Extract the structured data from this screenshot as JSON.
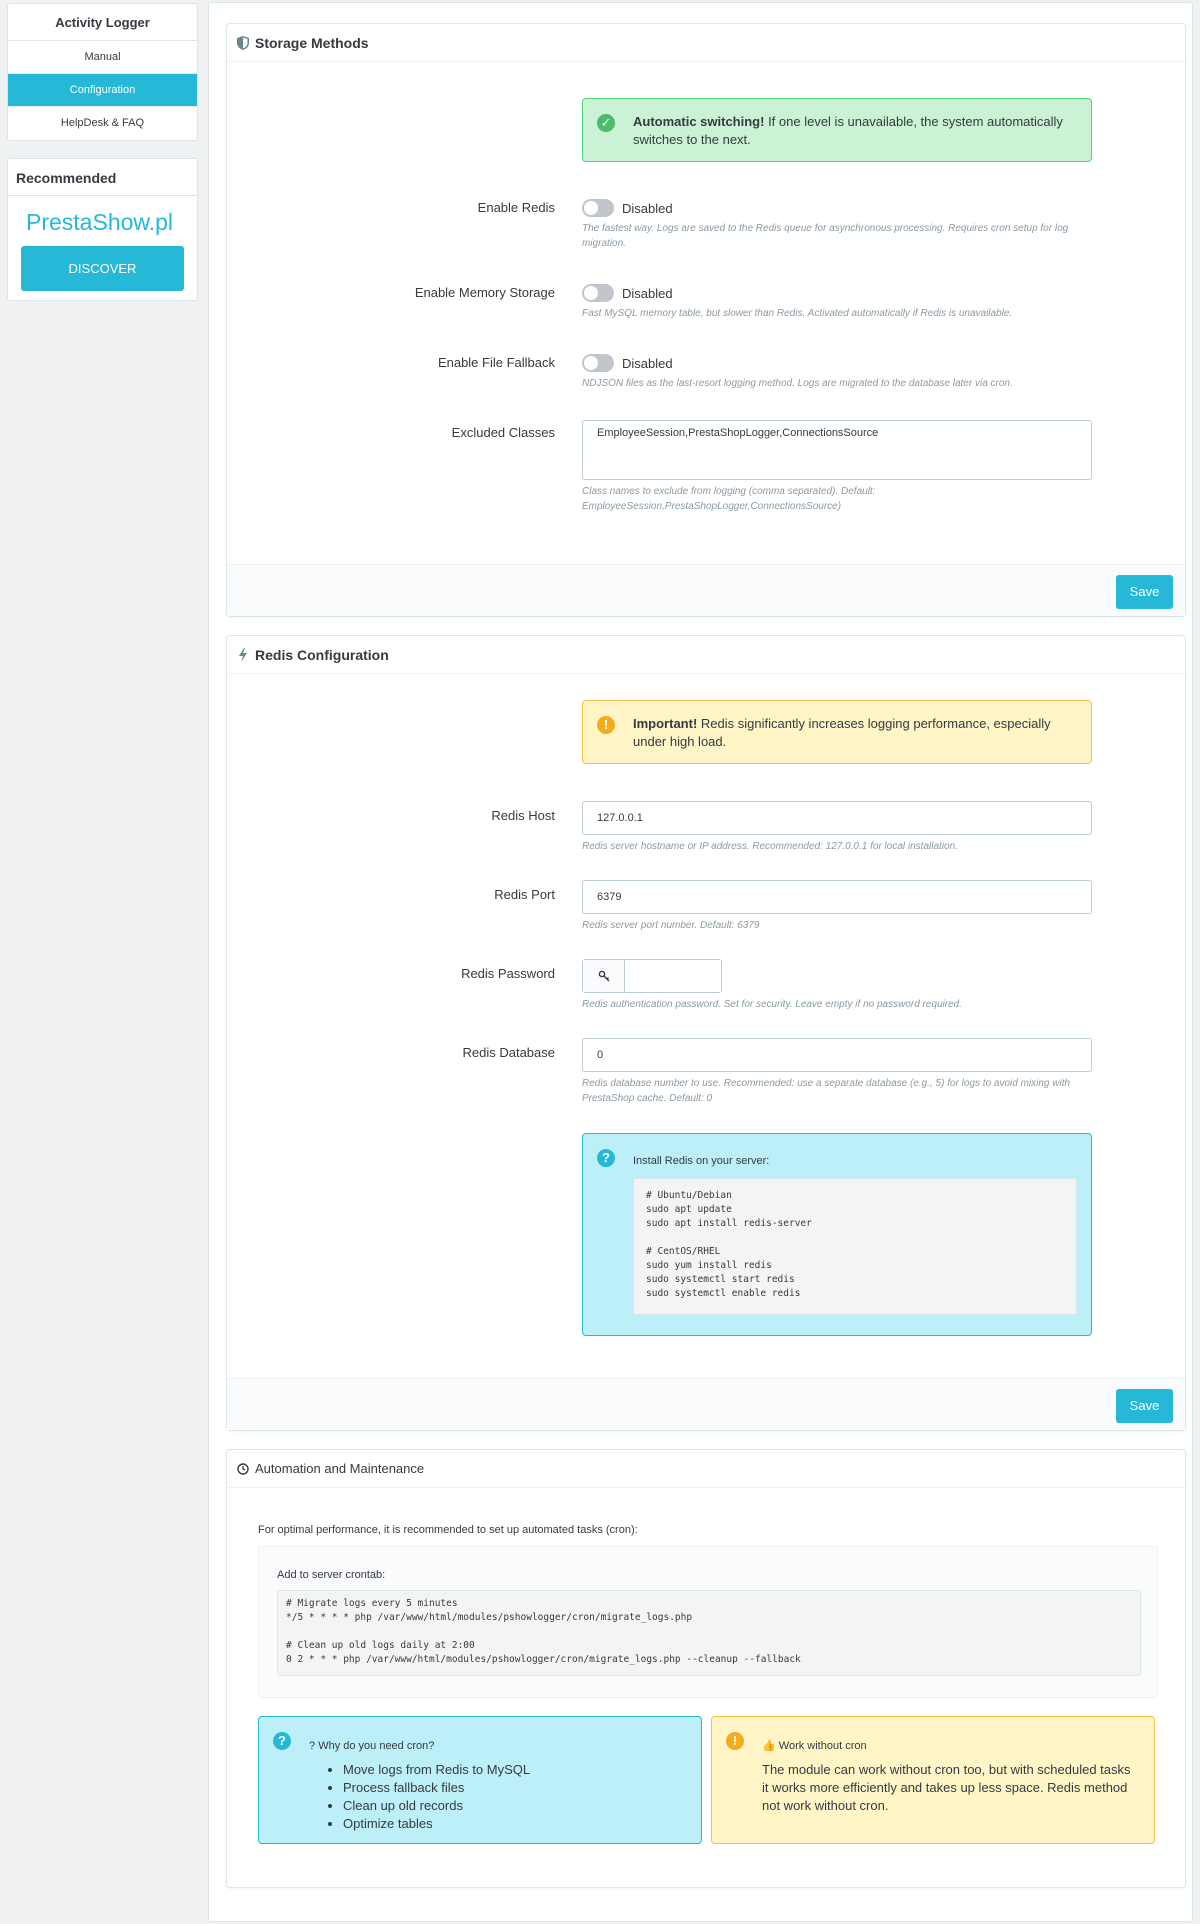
{
  "sidebar": {
    "title": "Activity Logger",
    "items": [
      {
        "label": "Manual",
        "active": false
      },
      {
        "label": "Configuration",
        "active": true
      },
      {
        "label": "HelpDesk & FAQ",
        "active": false
      }
    ],
    "recommended": {
      "title": "Recommended",
      "logo_text": "PrestaShow.pl",
      "button": "DISCOVER"
    }
  },
  "storage": {
    "title": "Storage Methods",
    "alert_bold": "Automatic switching!",
    "alert_text": " If one level is unavailable, the system automatically switches to the next.",
    "redis": {
      "label": "Enable Redis",
      "state": "Disabled",
      "help": "The fastest way. Logs are saved to the Redis queue for asynchronous processing. Requires cron setup for log migration."
    },
    "memory": {
      "label": "Enable Memory Storage",
      "state": "Disabled",
      "help": "Fast MySQL memory table, but slower than Redis. Activated automatically if Redis is unavailable."
    },
    "file": {
      "label": "Enable File Fallback",
      "state": "Disabled",
      "help": "NDJSON files as the last-resort logging method. Logs are migrated to the database later via cron."
    },
    "excluded": {
      "label": "Excluded Classes",
      "value": "EmployeeSession,PrestaShopLogger,ConnectionsSource",
      "help": "Class names to exclude from logging (comma separated). Default: EmployeeSession,PrestaShopLogger,ConnectionsSource)"
    },
    "save": "Save"
  },
  "redis_config": {
    "title": "Redis Configuration",
    "alert_bold": "Important!",
    "alert_text": " Redis significantly increases logging performance, especially under high load.",
    "host": {
      "label": "Redis Host",
      "value": "127.0.0.1",
      "help": "Redis server hostname or IP address. Recommended: 127.0.0.1 for local installation."
    },
    "port": {
      "label": "Redis Port",
      "value": "6379",
      "help": "Redis server port number. Default: 6379"
    },
    "password": {
      "label": "Redis Password",
      "value": "",
      "help": "Redis authentication password. Set for security. Leave empty if no password required."
    },
    "database": {
      "label": "Redis Database",
      "value": "0",
      "help": "Redis database number to use. Recommended: use a separate database (e.g., 5) for logs to avoid mixing with PrestaShop cache. Default: 0"
    },
    "install_title": "Install Redis on your server:",
    "install_code": "# Ubuntu/Debian\nsudo apt update\nsudo apt install redis-server\n\n# CentOS/RHEL\nsudo yum install redis\nsudo systemctl start redis\nsudo systemctl enable redis",
    "save": "Save"
  },
  "automation": {
    "title": "Automation and Maintenance",
    "intro": "For optimal performance, it is recommended to set up automated tasks (cron):",
    "crontab_label": "Add to server crontab:",
    "crontab_code": "# Migrate logs every 5 minutes\n*/5 * * * * php /var/www/html/modules/pshowlogger/cron/migrate_logs.php\n\n# Clean up old logs daily at 2:00\n0 2 * * * php /var/www/html/modules/pshowlogger/cron/migrate_logs.php --cleanup --fallback",
    "why": {
      "title": "Why do you need cron?",
      "items": [
        "Move logs from Redis to MySQL",
        "Process fallback files",
        "Clean up old records",
        "Optimize tables"
      ]
    },
    "without": {
      "title": "Work without cron",
      "text": "The module can work without cron too, but with scheduled tasks it works more efficiently and takes up less space. Redis method not work without cron."
    }
  },
  "colors": {
    "accent": "#25b9d7",
    "success": "#4cbb6c",
    "warning": "#f5ab1f"
  }
}
